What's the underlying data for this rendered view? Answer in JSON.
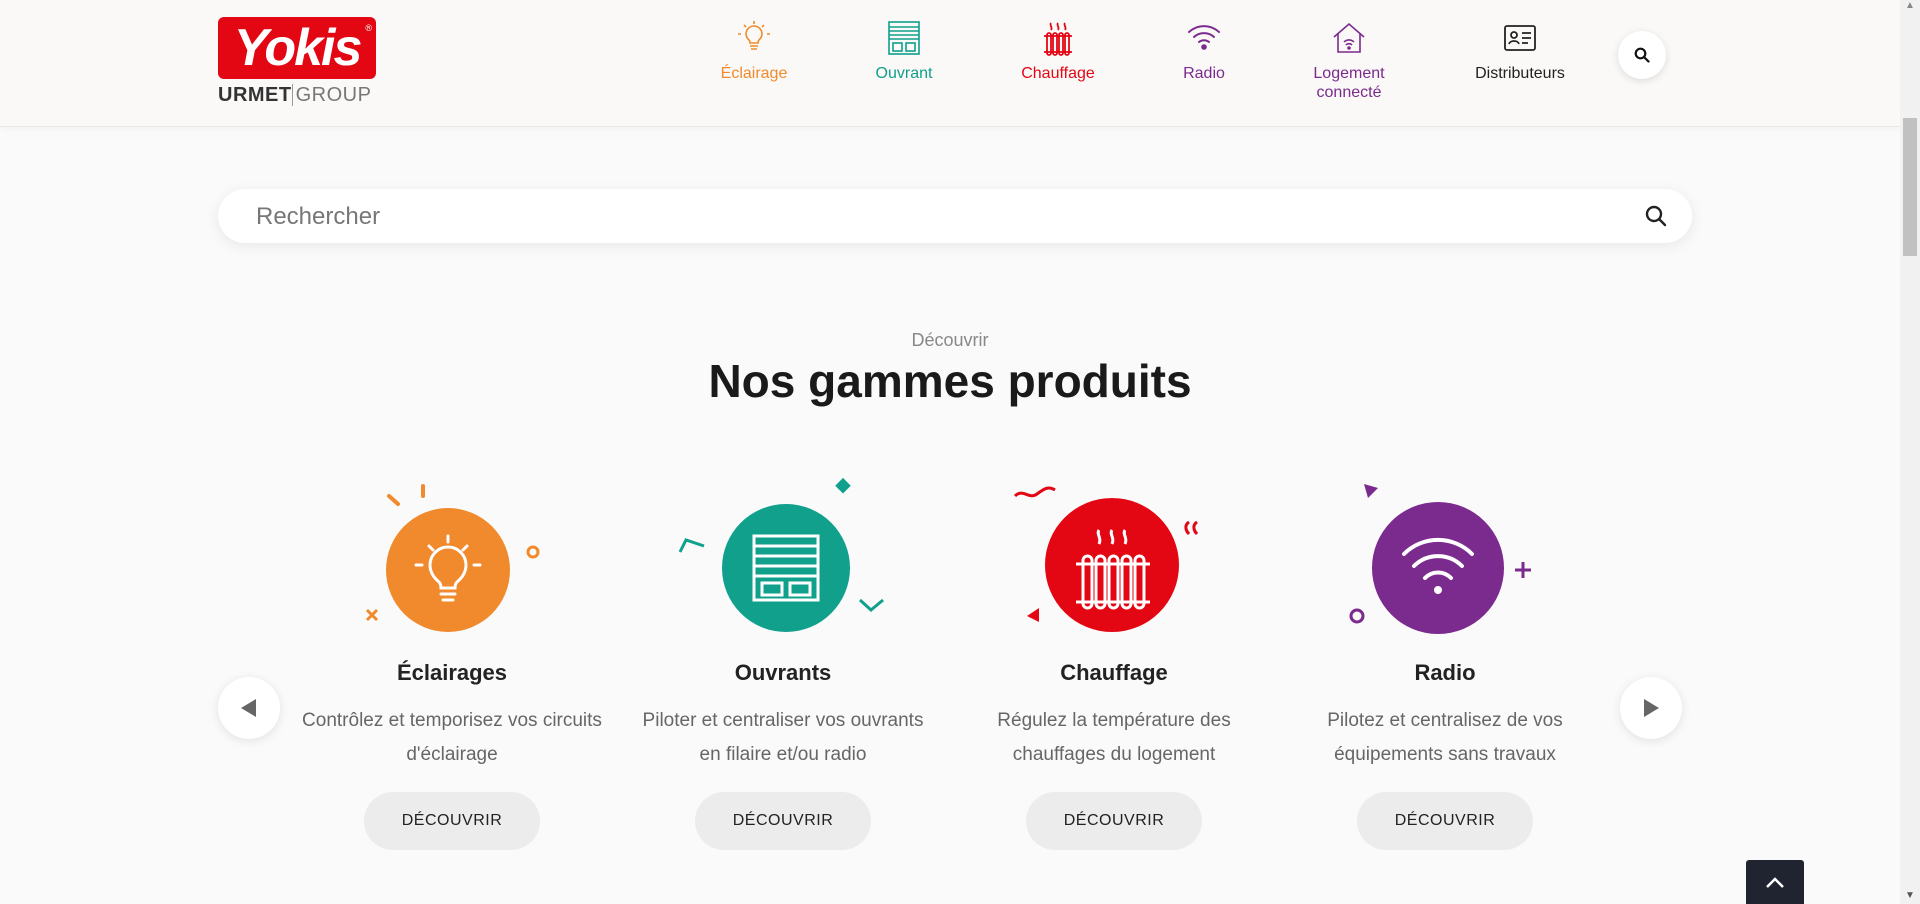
{
  "header": {
    "logo": {
      "brand": "Yokis",
      "sub_left": "URMET",
      "sub_right": "GROUP"
    },
    "nav": [
      {
        "label": "Éclairage",
        "icon": "lightbulb-icon",
        "color": "#f08a2c"
      },
      {
        "label": "Ouvrant",
        "icon": "shutter-icon",
        "color": "#10a08b"
      },
      {
        "label": "Chauffage",
        "icon": "radiator-icon",
        "color": "#e30613"
      },
      {
        "label": "Radio",
        "icon": "wifi-icon",
        "color": "#7b2a8e"
      },
      {
        "label": "Logement connecté",
        "icon": "smart-home-icon",
        "color": "#7b2a8e"
      },
      {
        "label": "Distributeurs",
        "icon": "contact-card-icon",
        "color": "#222222"
      }
    ],
    "search_icon": "search-icon"
  },
  "search": {
    "placeholder": "Rechercher"
  },
  "section": {
    "kicker": "Découvrir",
    "title": "Nos gammes produits"
  },
  "carousel": {
    "cards": [
      {
        "title": "Éclairages",
        "description": "Contrôlez et temporisez vos circuits d'éclairage",
        "button": "DÉCOUVRIR",
        "color": "#f08a2c",
        "icon": "lightbulb-icon"
      },
      {
        "title": "Ouvrants",
        "description": "Piloter et centraliser vos ouvrants en filaire et/ou radio",
        "button": "DÉCOUVRIR",
        "color": "#10a08b",
        "icon": "shutter-icon"
      },
      {
        "title": "Chauffage",
        "description": "Régulez la température des chauffages du logement",
        "button": "DÉCOUVRIR",
        "color": "#e30613",
        "icon": "radiator-icon"
      },
      {
        "title": "Radio",
        "description": "Pilotez et centralisez de vos équipements sans travaux",
        "button": "DÉCOUVRIR",
        "color": "#7b2a8e",
        "icon": "wifi-icon"
      }
    ],
    "prev_icon": "arrow-left-icon",
    "next_icon": "arrow-right-icon"
  },
  "back_to_top_icon": "chevron-up-icon"
}
